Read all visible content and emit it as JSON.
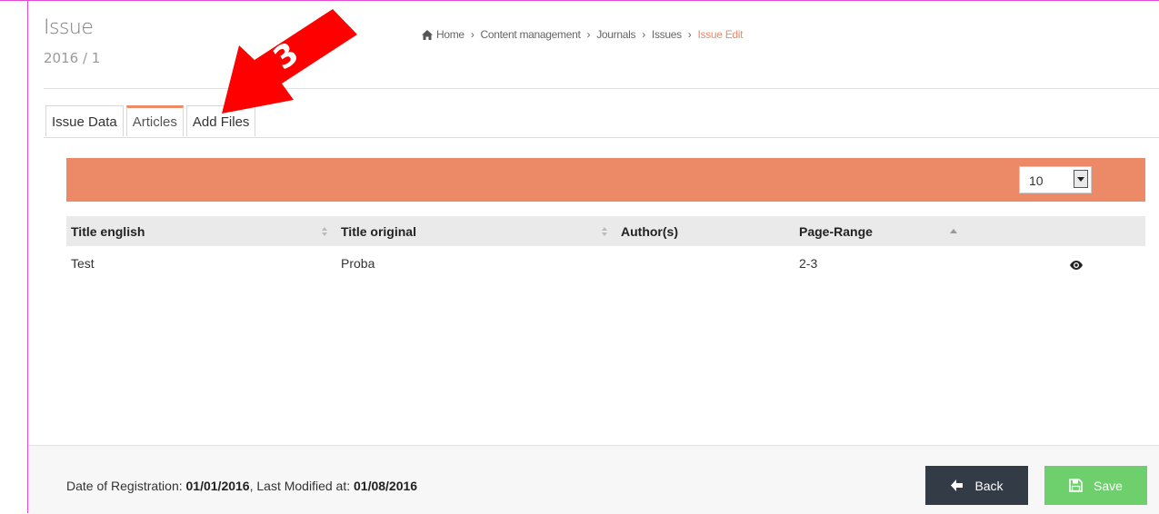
{
  "header": {
    "title": "Issue",
    "subtitle": "2016 / 1"
  },
  "breadcrumb": {
    "items": [
      "Home",
      "Content management",
      "Journals",
      "Issues"
    ],
    "active": "Issue Edit"
  },
  "tabs": [
    {
      "label": "Issue Data",
      "active": false
    },
    {
      "label": "Articles",
      "active": true
    },
    {
      "label": "Add Files",
      "active": false
    }
  ],
  "table_controls": {
    "page_size": "10"
  },
  "table": {
    "columns": [
      "Title english",
      "Title original",
      "Author(s)",
      "Page-Range",
      ""
    ],
    "rows": [
      {
        "title_english": "Test",
        "title_original": "Proba",
        "authors": "",
        "page_range": "2-3"
      }
    ]
  },
  "footer": {
    "registration_label": "Date of Registration:",
    "registration_date": "01/01/2016",
    "modified_label": ", Last Modified at:",
    "modified_date": "01/08/2016"
  },
  "buttons": {
    "back": "Back",
    "save": "Save"
  },
  "annotation": {
    "number": "3"
  },
  "colors": {
    "accent": "#ec8a67",
    "save": "#6dd06d",
    "back": "#333b47",
    "annotation": "#ff0000"
  }
}
